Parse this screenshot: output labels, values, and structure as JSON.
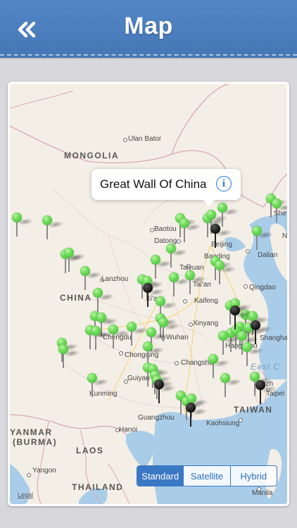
{
  "nav": {
    "title": "Map",
    "back_icon": "double-chevron-left-icon"
  },
  "callout": {
    "title": "Great Wall Of China",
    "info_icon": "info-icon",
    "info_glyph": "i"
  },
  "map": {
    "countries": {
      "mongolia": "MONGOLIA",
      "china": "CHINA",
      "laos": "LAOS",
      "thailand": "THAILAND",
      "taiwan": "TAIWAN",
      "myanmar_line1": "YANMAR",
      "myanmar_line2": "(BURMA)"
    },
    "seas": {
      "east_china": "East C"
    },
    "cities": {
      "ulan_bator": "Ulan Bator",
      "baotou": "Baotou",
      "datong": "Datong",
      "beijing": "Beijing",
      "baoding": "Baoding",
      "taiyuan": "Taiyuan",
      "dalian": "Dalian",
      "lanzhou": "Lanzhou",
      "tai_an": "Tai'an",
      "qingdao": "Qingdao",
      "xi_an": "Xi'an",
      "kaifeng": "Kaifeng",
      "xinyang": "Xinyang",
      "chengdu": "Chengdu",
      "wuhan": "Wuhan",
      "hangzhou": "Hangzhou",
      "shanghai": "Shanghai",
      "chongqing": "Chongqing",
      "changsha": "Changsha",
      "guiyang": "Guiyan",
      "fuzhou": "Fuzh",
      "taipei": "Taipei",
      "kunming": "Kunming",
      "guangzhou": "Guangzhou",
      "kaohsiung": "Kaohsiung",
      "hanoi": "Hanoi",
      "yangon": "Yangon",
      "manila": "Manila",
      "she": "She",
      "n": "N"
    },
    "legal": "Legal"
  },
  "map_type": {
    "options": [
      "Standard",
      "Satellite",
      "Hybrid"
    ],
    "selected": "Standard"
  },
  "colors": {
    "nav_bar": "#4a7dbc",
    "pin_green": "#5fcf4e",
    "pin_selected": "#111111",
    "segment_accent": "#3b78c4",
    "water": "#a9cde9",
    "land": "#f4efe6"
  }
}
